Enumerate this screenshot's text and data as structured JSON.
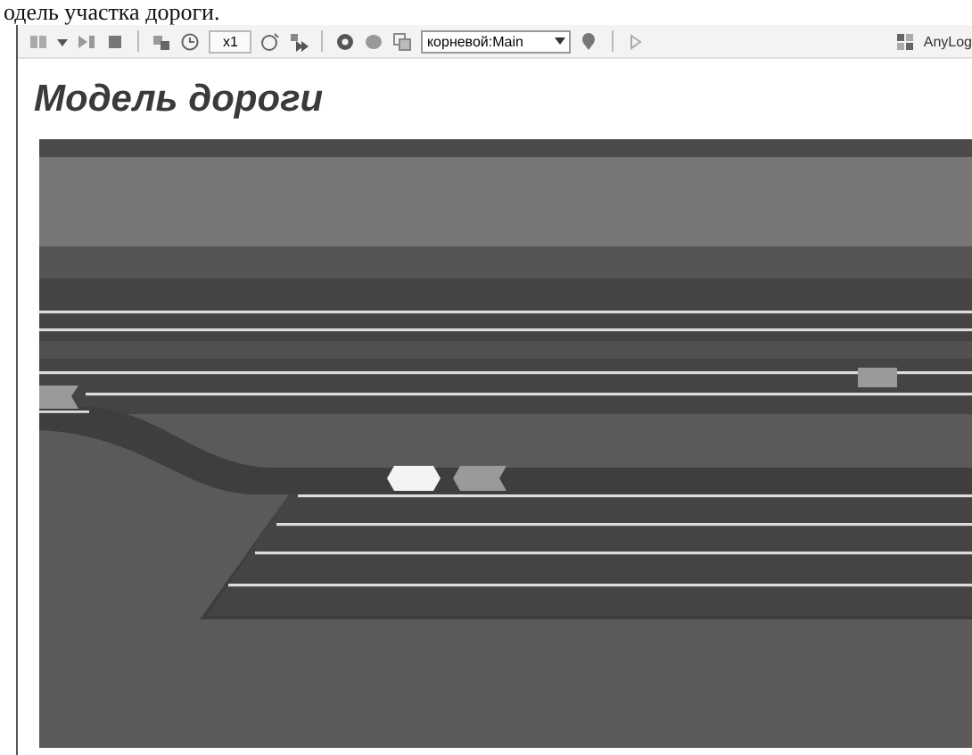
{
  "caption": "одель участка дороги.",
  "toolbar": {
    "speed": "x1",
    "view_selector": "корневой:Main",
    "brand": "AnyLog"
  },
  "title": "Модель дороги",
  "cars": [
    {
      "color": "#9a9a9a"
    },
    {
      "color": "#9a9a9a"
    },
    {
      "color": "#f4f4f4"
    },
    {
      "color": "#9a9a9a"
    }
  ]
}
